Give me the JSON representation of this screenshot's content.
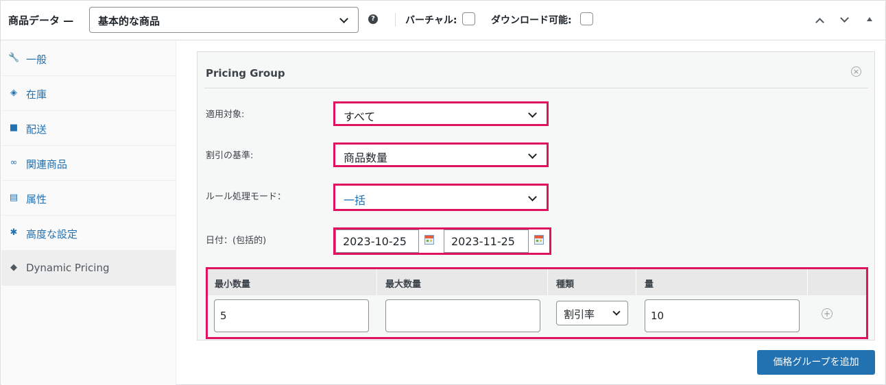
{
  "header": {
    "title": "商品データ —",
    "product_type": "基本的な商品",
    "help_icon": "?",
    "virtual_label": "バーチャル:",
    "downloadable_label": "ダウンロード可能:"
  },
  "sidebar": {
    "items": [
      {
        "icon": "wrench-icon",
        "glyph": "🔧",
        "label": "一般"
      },
      {
        "icon": "tag-icon",
        "glyph": "◈",
        "label": "在庫"
      },
      {
        "icon": "truck-icon",
        "glyph": "■",
        "label": "配送"
      },
      {
        "icon": "link-icon",
        "glyph": "∞",
        "label": "関連商品"
      },
      {
        "icon": "table-icon",
        "glyph": "▤",
        "label": "属性"
      },
      {
        "icon": "gear-icon",
        "glyph": "✱",
        "label": "高度な設定"
      },
      {
        "icon": "tag-solid-icon",
        "glyph": "◆",
        "label": "Dynamic Pricing"
      }
    ]
  },
  "pricing_group": {
    "title": "Pricing Group",
    "applies_to_label": "適用対象:",
    "applies_to_value": "すべて",
    "discount_basis_label": "割引の基準:",
    "discount_basis_value": "商品数量",
    "rule_mode_label": "ルール処理モード：",
    "rule_mode_value": "一括",
    "dates_label": "日付：(包括的)",
    "date_from": "2023-10-25",
    "date_to": "2023-11-25",
    "table": {
      "headers": [
        "最小数量",
        "最大数量",
        "種類",
        "量"
      ],
      "row": {
        "min_qty": "5",
        "max_qty": "",
        "type": "割引率",
        "amount": "10"
      }
    }
  },
  "add_button_label": "価格グループを追加",
  "colors": {
    "accent": "#2271b1",
    "highlight": "#e0115f"
  }
}
